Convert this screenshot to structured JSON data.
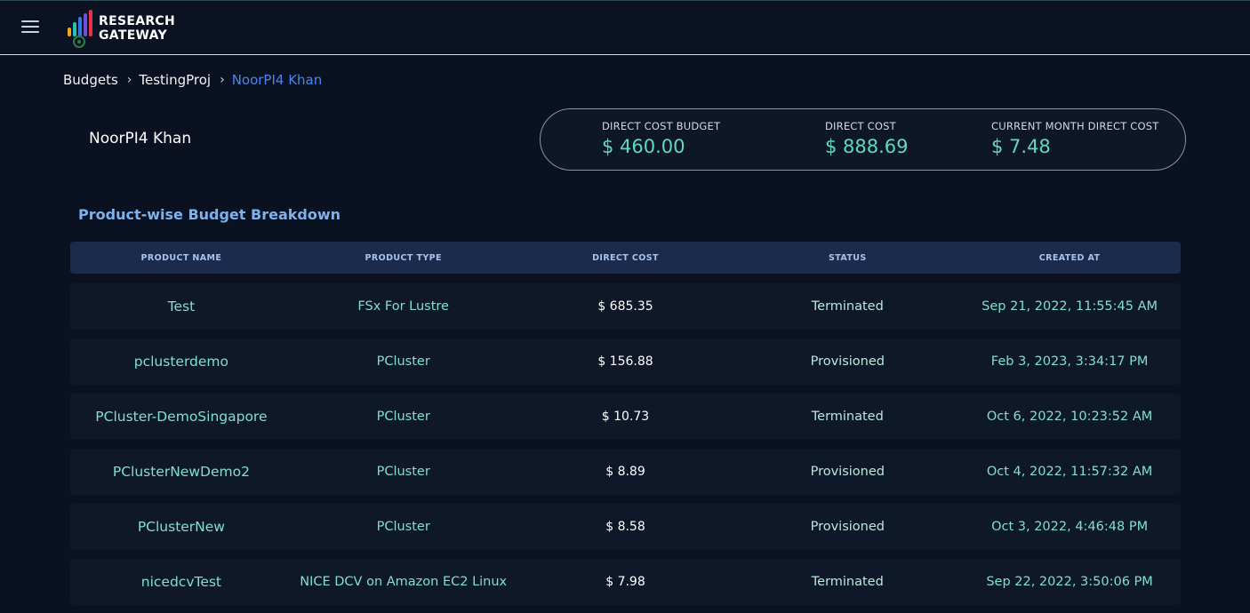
{
  "app": {
    "brand_line1": "RESEARCH",
    "brand_line2": "GATEWAY"
  },
  "breadcrumb": [
    "Budgets",
    "TestingProj",
    "NoorPI4 Khan"
  ],
  "page_title": "NoorPI4 Khan",
  "summary": {
    "direct_cost_budget_label": "DIRECT COST BUDGET",
    "direct_cost_budget_value": "$ 460.00",
    "direct_cost_label": "DIRECT COST",
    "direct_cost_value": "$ 888.69",
    "current_month_label": "CURRENT MONTH DIRECT COST",
    "current_month_value": "$ 7.48"
  },
  "section_title": "Product-wise Budget Breakdown",
  "table": {
    "headers": [
      "PRODUCT NAME",
      "PRODUCT TYPE",
      "DIRECT COST",
      "STATUS",
      "CREATED AT"
    ],
    "rows": [
      [
        "Test",
        "FSx For Lustre",
        "$ 685.35",
        "Terminated",
        "Sep 21, 2022, 11:55:45 AM"
      ],
      [
        "pclusterdemo",
        "PCluster",
        "$ 156.88",
        "Provisioned",
        "Feb 3, 2023, 3:34:17 PM"
      ],
      [
        "PCluster-DemoSingapore",
        "PCluster",
        "$ 10.73",
        "Terminated",
        "Oct 6, 2022, 10:23:52 AM"
      ],
      [
        "PClusterNewDemo2",
        "PCluster",
        "$ 8.89",
        "Provisioned",
        "Oct 4, 2022, 11:57:32 AM"
      ],
      [
        "PClusterNew",
        "PCluster",
        "$ 8.58",
        "Provisioned",
        "Oct 3, 2022, 4:46:48 PM"
      ],
      [
        "nicedcvTest",
        "NICE DCV on Amazon EC2 Linux",
        "$ 7.98",
        "Terminated",
        "Sep 22, 2022, 3:50:06 PM"
      ]
    ]
  },
  "colors": {
    "accent": "#5fd8c3",
    "header_bg": "#1b2b4b",
    "page_bg": "#0a1120",
    "link": "#4b86e8"
  }
}
